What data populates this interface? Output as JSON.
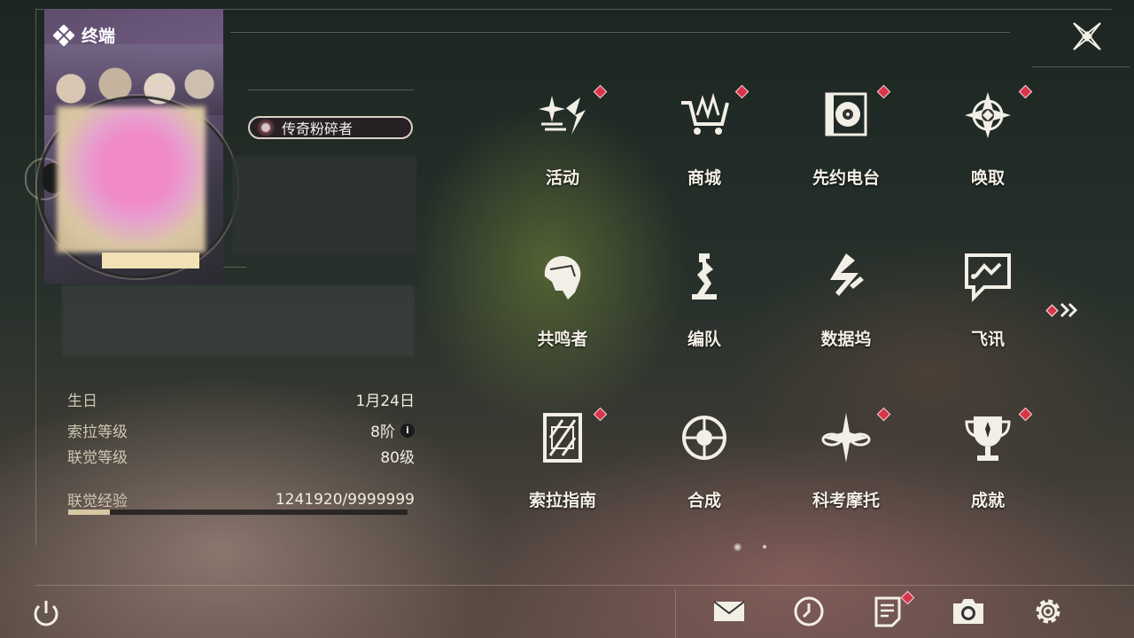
{
  "terminal": {
    "title": "终端"
  },
  "profile": {
    "title_badge": "传奇粉碎者",
    "details": [
      {
        "label": "生日",
        "value": "1月24日"
      },
      {
        "label": "索拉等级",
        "value": "8阶",
        "info": "i"
      },
      {
        "label": "联觉等级",
        "value": "80级"
      },
      {
        "label": "联觉经验",
        "value": "1241920/9999999"
      }
    ],
    "exp_progress": 0.124
  },
  "menu": {
    "items": [
      {
        "label": "活动",
        "icon": "sparkle-icon",
        "badge": true
      },
      {
        "label": "商城",
        "icon": "shopping-cart-icon",
        "badge": true
      },
      {
        "label": "先约电台",
        "icon": "radio-icon",
        "badge": true
      },
      {
        "label": "唤取",
        "icon": "compass-star-icon",
        "badge": true
      },
      {
        "label": "共鸣者",
        "icon": "character-portrait-icon",
        "badge": false
      },
      {
        "label": "编队",
        "icon": "chess-piece-icon",
        "badge": false
      },
      {
        "label": "数据坞",
        "icon": "data-dock-icon",
        "badge": false
      },
      {
        "label": "飞讯",
        "icon": "chat-bubble-icon",
        "badge": false
      },
      {
        "label": "索拉指南",
        "icon": "guide-book-icon",
        "badge": true
      },
      {
        "label": "合成",
        "icon": "synthesis-icon",
        "badge": false
      },
      {
        "label": "科考摩托",
        "icon": "motorbike-icon",
        "badge": true
      },
      {
        "label": "成就",
        "icon": "trophy-icon",
        "badge": true
      }
    ],
    "page": {
      "current": 1,
      "total": 2
    }
  },
  "bottom_bar": {
    "items": [
      {
        "name": "mail-icon"
      },
      {
        "name": "clock-icon"
      },
      {
        "name": "notice-icon",
        "badge": true
      },
      {
        "name": "camera-icon"
      },
      {
        "name": "settings-icon"
      }
    ]
  },
  "colors": {
    "accent_red": "#d8344a",
    "text": "#f4f0e6",
    "label": "#cfc6b0"
  }
}
